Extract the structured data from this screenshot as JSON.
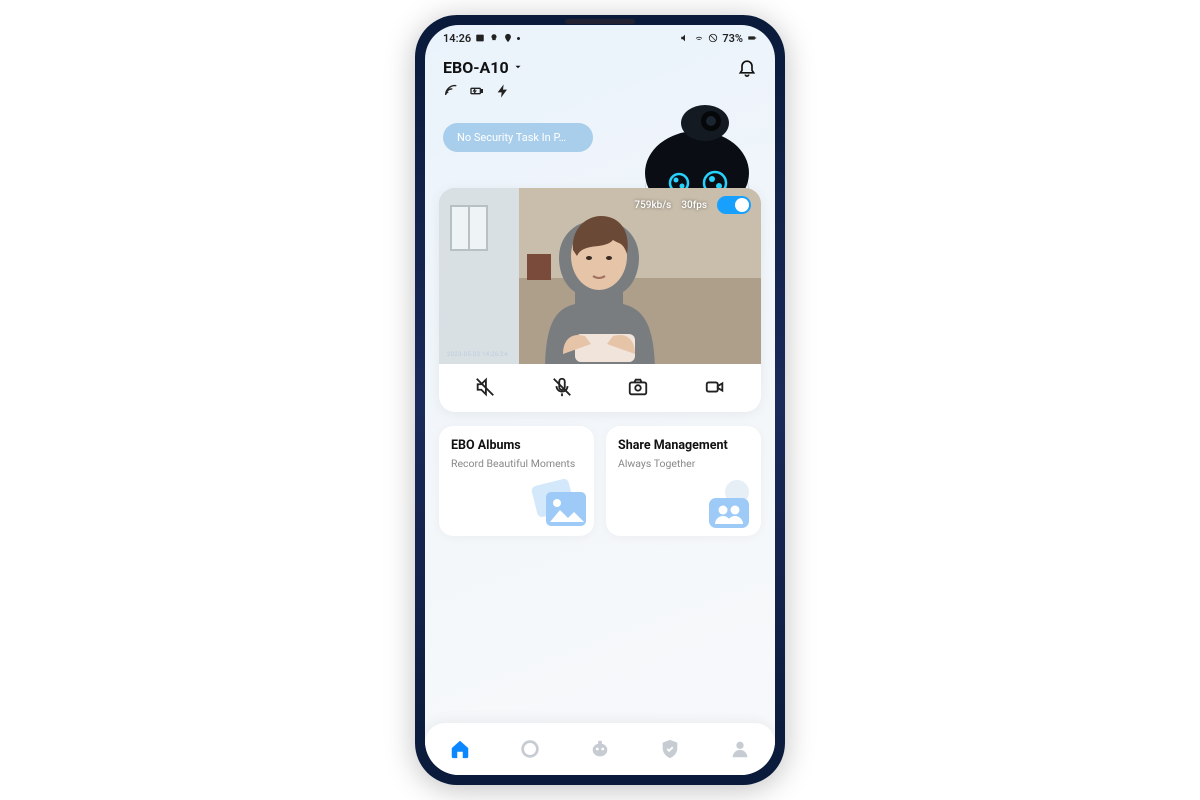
{
  "statusbar": {
    "time": "14:26",
    "battery": "73%"
  },
  "header": {
    "device_name": "EBO-A10"
  },
  "status_pill": "No Security Task In P…",
  "video": {
    "bitrate": "759kb/s",
    "fps": "30fps",
    "timestamp": "2023-05-03 14:26:24"
  },
  "cards": {
    "albums": {
      "title": "EBO Albums",
      "subtitle": "Record Beautiful Moments"
    },
    "share": {
      "title": "Share Management",
      "subtitle": "Always Together"
    }
  }
}
